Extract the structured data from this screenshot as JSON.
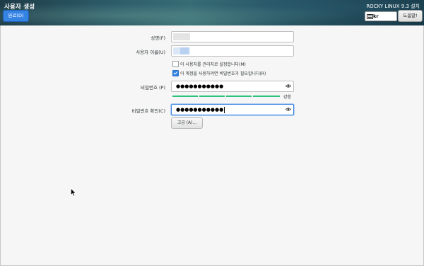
{
  "header": {
    "title": "사용자 생성",
    "done_label": "완료(D)",
    "install_title": "ROCKY LINUX 9.3 설치",
    "keyboard_layout": "kr",
    "help_label": "도움말!"
  },
  "form": {
    "fullname_label": "성명(F)",
    "username_label": "사용자 이름(U)",
    "admin_checkbox": {
      "label": "이 사용자를 관리자로 설정합니다(M)",
      "checked": false
    },
    "password_checkbox": {
      "label": "이 계정을 사용하려면 비밀번호가 필요합니다(R)",
      "checked": true
    },
    "password_label": "비밀번호 (P)",
    "password_mask": "●●●●●●●●●●●",
    "strength_label": "강함",
    "strength_level": 1.0,
    "confirm_label": "비밀번호 확인(C)",
    "confirm_mask": "●●●●●●●●●●●",
    "advanced_label": "고급 (A)..."
  },
  "colors": {
    "accent": "#3584e4",
    "strength": "#2ec27e"
  },
  "icons": {
    "reveal": "eye-icon",
    "keyboard": "keyboard-icon",
    "pointer": "mouse-pointer-icon"
  }
}
